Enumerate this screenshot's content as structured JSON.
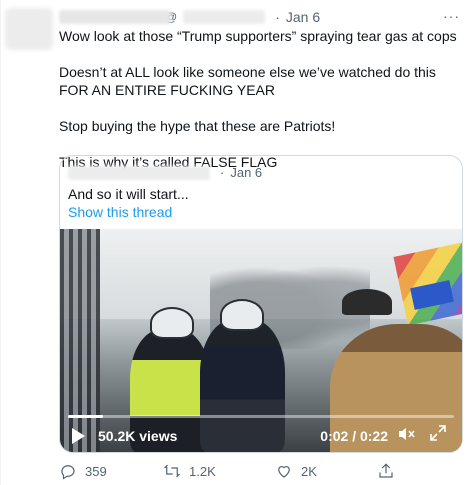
{
  "tweet": {
    "at_symbol": "@",
    "separator": "·",
    "time": "Jan 6",
    "more_icon": "···",
    "paragraphs": [
      "Wow look at those “Trump supporters” spraying tear gas at cops",
      "Doesn’t at ALL look like someone else we’ve watched do this FOR AN ENTIRE FUCKING YEAR",
      "Stop buying the hype that these are Patriots!",
      "This is why it’s called FALSE FLAG"
    ]
  },
  "quote": {
    "separator": "·",
    "time": "Jan 6",
    "text": "And so it will start...",
    "link": "Show this thread",
    "video": {
      "views": "50.2K views",
      "time": "0:02 / 0:22",
      "progress_fraction": 0.09,
      "mute_icon": "speaker-muted-icon",
      "expand_icon": "expand-icon"
    }
  },
  "actions": {
    "replies": "359",
    "retweets": "1.2K",
    "likes": "2K"
  },
  "colors": {
    "link": "#1d9bf0",
    "muted": "#536471",
    "text": "#0f1419",
    "border": "#cfd9de"
  }
}
